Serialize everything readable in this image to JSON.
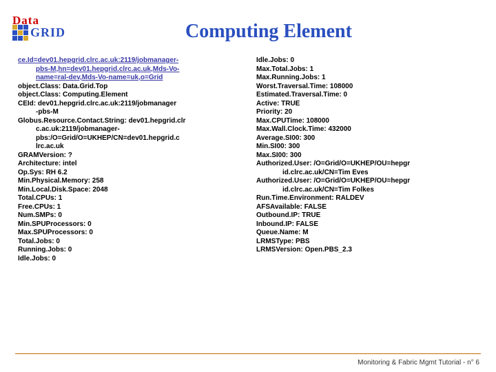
{
  "logo": {
    "top": "Data",
    "bottom": "GRID"
  },
  "title": "Computing Element",
  "left": {
    "link1": "ce.Id=dev01.hepgrid.clrc.ac.uk:2119/jobmanager-",
    "link2": "pbs-M,hn=dev01.hepgrid.clrc.ac.uk,Mds-Vo-",
    "link3": "name=ral-dev,Mds-Vo-name=uk,o=Grid",
    "l01": "object.Class: Data.Grid.Top",
    "l02": "object.Class: Computing.Element",
    "l03": "CEId: dev01.hepgrid.clrc.ac.uk:2119/jobmanager",
    "l03b": "-pbs-M",
    "l04": "Globus.Resource.Contact.String: dev01.hepgrid.clr",
    "l04b": "c.ac.uk:2119/jobmanager-",
    "l04c": "pbs:/O=Grid/O=UKHEP/CN=dev01.hepgrid.c",
    "l04d": "lrc.ac.uk",
    "l05": "GRAMVersion: ?",
    "l06": "Architecture: intel",
    "l07": "Op.Sys: RH 6.2",
    "l08": "Min.Physical.Memory: 258",
    "l09": "Min.Local.Disk.Space: 2048",
    "l10": "Total.CPUs: 1",
    "l11": "Free.CPUs: 1",
    "l12": "Num.SMPs: 0",
    "l13": "Min.SPUProcessors: 0",
    "l14": "Max.SPUProcessors: 0",
    "l15": "Total.Jobs: 0",
    "l16": "Running.Jobs: 0",
    "l17": "Idle.Jobs: 0"
  },
  "right": {
    "r01": "Idle.Jobs: 0",
    "r02": "Max.Total.Jobs: 1",
    "r03": "Max.Running.Jobs: 1",
    "r04": "Worst.Traversal.Time: 108000",
    "r05": "Estimated.Traversal.Time: 0",
    "r06": "Active: TRUE",
    "r07": "Priority: 20",
    "r08": "Max.CPUTime: 108000",
    "r09": "Max.Wall.Clock.Time: 432000",
    "r10": "Average.SI00: 300",
    "r11": "Min.SI00: 300",
    "r12": "Max.SI00: 300",
    "r13": "Authorized.User: /O=Grid/O=UKHEP/OU=hepgr",
    "r13b": "id.clrc.ac.uk/CN=Tim Eves",
    "r14": "Authorized.User: /O=Grid/O=UKHEP/OU=hepgr",
    "r14b": "id.clrc.ac.uk/CN=Tim Folkes",
    "r15": "Run.Time.Environment: RALDEV",
    "r16": "AFSAvailable: FALSE",
    "r17": "Outbound.IP: TRUE",
    "r18": "Inbound.IP: FALSE",
    "r19": "Queue.Name: M",
    "r20": "LRMSType: PBS",
    "r21": "LRMSVersion: Open.PBS_2.3"
  },
  "footer": "Monitoring & Fabric Mgmt Tutorial - n° 6"
}
